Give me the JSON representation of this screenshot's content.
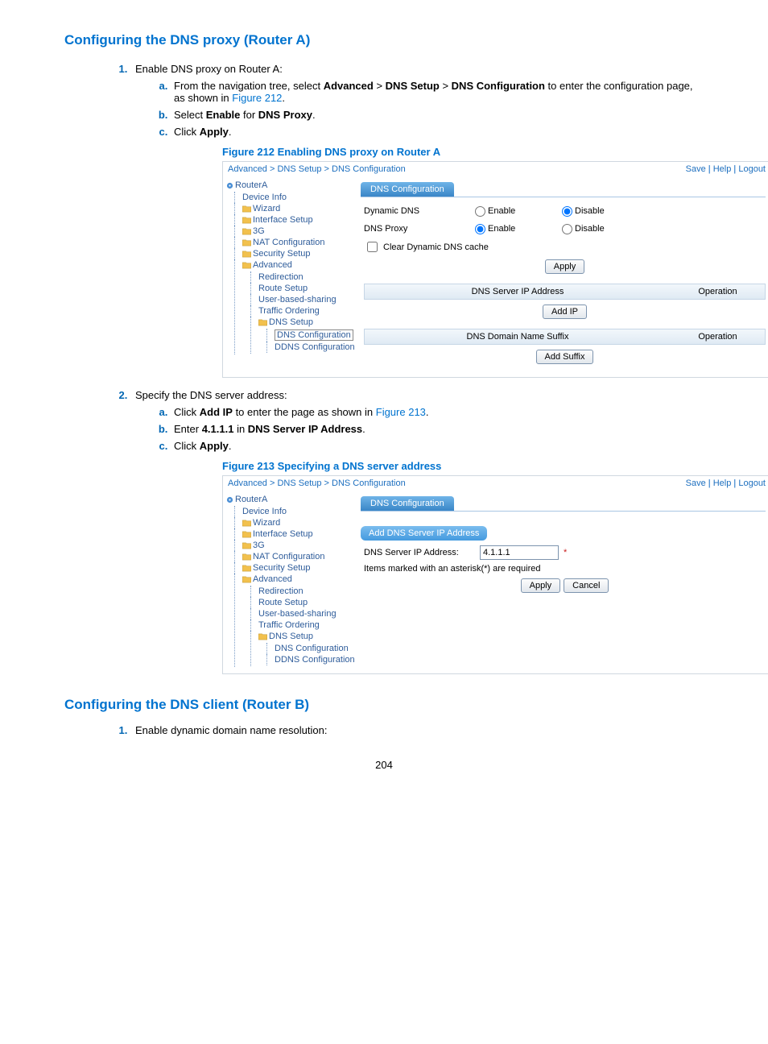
{
  "headings": {
    "h1a": "Configuring the DNS proxy (Router A)",
    "h1b": "Configuring the DNS client (Router B)"
  },
  "steps1": {
    "main1": "Enable DNS proxy on Router A:",
    "a_pre": "From the navigation tree, select ",
    "a_b1": "Advanced",
    "a_b2": "DNS Setup",
    "a_b3": "DNS Configuration",
    "a_mid": " to enter the configuration page, as shown in ",
    "a_link": "Figure 212",
    "a_end": ".",
    "b_pre": "Select ",
    "b_b1": "Enable",
    "b_mid": " for ",
    "b_b2": "DNS Proxy",
    "b_end": ".",
    "c_pre": "Click ",
    "c_b1": "Apply",
    "c_end": "."
  },
  "steps2": {
    "main1": "Specify the DNS server address:",
    "a_pre": "Click ",
    "a_b1": "Add IP",
    "a_mid": " to enter the page as shown in ",
    "a_link": "Figure 213",
    "a_end": ".",
    "b_pre": "Enter ",
    "b_b1": "4.1.1.1",
    "b_mid": " in ",
    "b_b2": "DNS Server IP Address",
    "b_end": ".",
    "c_pre": "Click ",
    "c_b1": "Apply",
    "c_end": "."
  },
  "steps3": {
    "main1": "Enable dynamic domain name resolution:"
  },
  "fig212_caption": "Figure 212 Enabling DNS proxy on Router A",
  "fig213_caption": "Figure 213 Specifying a DNS server address",
  "breadcrumb": "Advanced > DNS Setup > DNS Configuration",
  "toplinks": {
    "save": "Save",
    "help": "Help",
    "logout": "Logout"
  },
  "sidebar": {
    "device": "RouterA",
    "items": [
      "Device Info",
      "Wizard",
      "Interface Setup",
      "3G",
      "NAT Configuration",
      "Security Setup",
      "Advanced"
    ],
    "adv_children": [
      "Redirection",
      "Route Setup",
      "User-based-sharing",
      "Traffic Ordering",
      "DNS Setup"
    ],
    "dns_children": [
      "DNS Configuration",
      "DDNS Configuration"
    ]
  },
  "panel212": {
    "tab": "DNS Configuration",
    "dynamic_dns": "Dynamic DNS",
    "dns_proxy": "DNS Proxy",
    "enable": "Enable",
    "disable": "Disable",
    "clear_cache": "Clear Dynamic DNS cache",
    "apply": "Apply",
    "dns_server_ip": "DNS Server IP Address",
    "operation": "Operation",
    "add_ip": "Add IP",
    "domain_suffix": "DNS Domain Name Suffix",
    "add_suffix": "Add Suffix"
  },
  "panel213": {
    "tab": "DNS Configuration",
    "subtab": "Add DNS Server IP Address",
    "dns_server_ip_label": "DNS Server IP Address:",
    "ip_value": "4.1.1.1",
    "note": "Items marked with an asterisk(*) are required",
    "apply": "Apply",
    "cancel": "Cancel"
  },
  "page_number": "204"
}
